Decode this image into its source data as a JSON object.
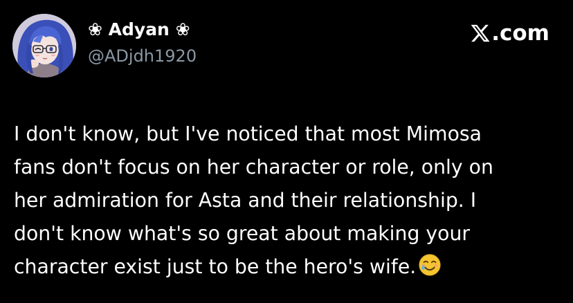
{
  "brand": {
    "text": ".com",
    "icon": "x-logo-icon"
  },
  "author": {
    "display_name": "❀ Adyan ❀",
    "handle": "@ADjdh1920",
    "avatar": "anime-girl-avatar"
  },
  "tweet": {
    "lines": [
      "I don't know, but I've noticed that most Mimosa",
      "fans don't focus on her character or role, only on",
      "her admiration for Asta and their relationship. I",
      "don't know what's so great about making your",
      "character exist just to be the hero's wife."
    ],
    "emoji": "smiling-face-with-tear-icon"
  },
  "colors": {
    "background": "#000000",
    "text": "#ffffff",
    "secondary_text": "#8b98a5",
    "avatar_hair": "#3f58c6"
  }
}
